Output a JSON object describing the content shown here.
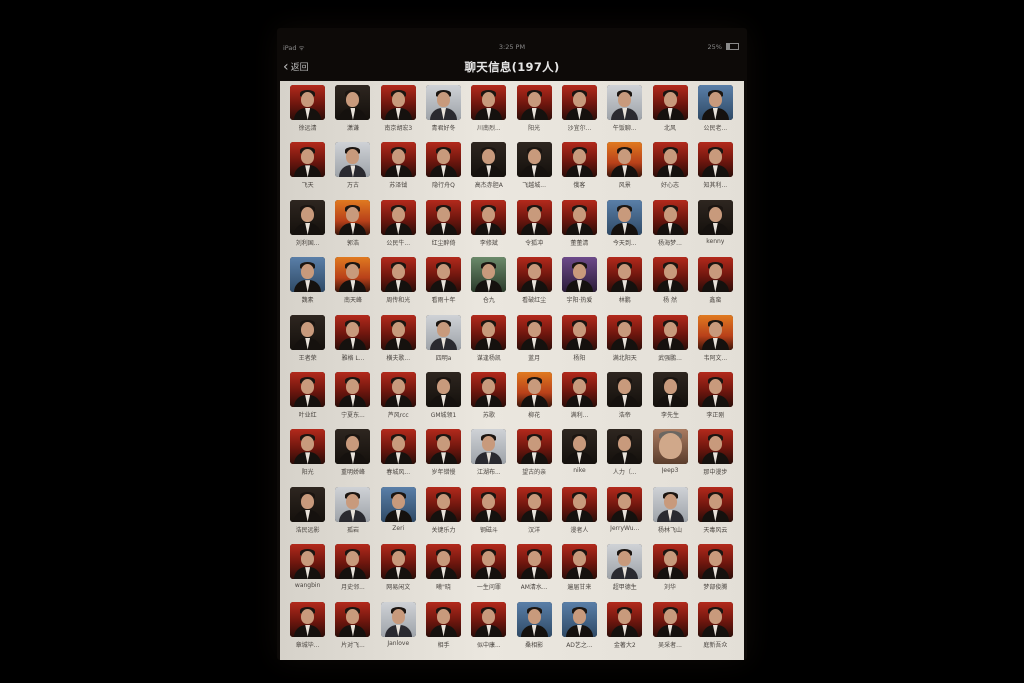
{
  "statusbar": {
    "device": "iPad ᯤ",
    "time": "3:25 PM",
    "battery": "25%"
  },
  "navbar": {
    "back_label": "返回",
    "title": "聊天信息(197人)"
  },
  "members": [
    {
      "name": "徐远清",
      "style": "red"
    },
    {
      "name": "潇谦",
      "style": "dark"
    },
    {
      "name": "南京胡宏3",
      "style": "red"
    },
    {
      "name": "青君好冬",
      "style": "light"
    },
    {
      "name": "川南烈...",
      "style": "red"
    },
    {
      "name": "阳光",
      "style": "red"
    },
    {
      "name": "沙宜尔...",
      "style": "red"
    },
    {
      "name": "午饭聊...",
      "style": "light"
    },
    {
      "name": "北风",
      "style": "red"
    },
    {
      "name": "公民老...",
      "style": "blue"
    },
    {
      "name": "飞天",
      "style": "red"
    },
    {
      "name": "万古",
      "style": "light"
    },
    {
      "name": "苏泽钺",
      "style": "red"
    },
    {
      "name": "隐行舟Q",
      "style": "red"
    },
    {
      "name": "高杰赤胆A",
      "style": "dark"
    },
    {
      "name": "飞越城...",
      "style": "dark"
    },
    {
      "name": "俄客",
      "style": "red"
    },
    {
      "name": "风景",
      "style": "orange"
    },
    {
      "name": "好心志",
      "style": "red"
    },
    {
      "name": "知其利...",
      "style": "red"
    },
    {
      "name": "刘利国...",
      "style": "dark"
    },
    {
      "name": "郭浩",
      "style": "orange"
    },
    {
      "name": "公民牛...",
      "style": "red"
    },
    {
      "name": "红尘醉倚",
      "style": "red"
    },
    {
      "name": "李修斌",
      "style": "red"
    },
    {
      "name": "令狐冲",
      "style": "red"
    },
    {
      "name": "董董清",
      "style": "red"
    },
    {
      "name": "今天到...",
      "style": "blue"
    },
    {
      "name": "杨海梦...",
      "style": "red"
    },
    {
      "name": "kenny",
      "style": "dark"
    },
    {
      "name": "魏素",
      "style": "blue"
    },
    {
      "name": "南天峰",
      "style": "orange"
    },
    {
      "name": "周传和光",
      "style": "red"
    },
    {
      "name": "看雨十年",
      "style": "red"
    },
    {
      "name": "仓九",
      "style": "green"
    },
    {
      "name": "看破红尘",
      "style": "red"
    },
    {
      "name": "宇阳·热爱",
      "style": "purple"
    },
    {
      "name": "林鹏",
      "style": "red"
    },
    {
      "name": "杨 然",
      "style": "red"
    },
    {
      "name": "鑫蛮",
      "style": "red"
    },
    {
      "name": "王者荣",
      "style": "dark"
    },
    {
      "name": "雅格 L...",
      "style": "red"
    },
    {
      "name": "横夫歌...",
      "style": "red"
    },
    {
      "name": "四明a",
      "style": "light"
    },
    {
      "name": "谋逢杨凯",
      "style": "red"
    },
    {
      "name": "蓝月",
      "style": "red"
    },
    {
      "name": "杨阳",
      "style": "red"
    },
    {
      "name": "满北阳天",
      "style": "red"
    },
    {
      "name": "武强鹏...",
      "style": "red"
    },
    {
      "name": "韦阿文...",
      "style": "orange"
    },
    {
      "name": "叶业红",
      "style": "red"
    },
    {
      "name": "宁夏东...",
      "style": "red"
    },
    {
      "name": "芦风rcc",
      "style": "red"
    },
    {
      "name": "GM城领1",
      "style": "dark"
    },
    {
      "name": "苏歌",
      "style": "red"
    },
    {
      "name": "柳花",
      "style": "orange"
    },
    {
      "name": "满利...",
      "style": "red"
    },
    {
      "name": "浩帝",
      "style": "dark"
    },
    {
      "name": "李先生",
      "style": "dark"
    },
    {
      "name": "李正刚",
      "style": "red"
    },
    {
      "name": "阳光",
      "style": "red"
    },
    {
      "name": "重明娇峰",
      "style": "dark"
    },
    {
      "name": "春城风...",
      "style": "red"
    },
    {
      "name": "岁年错慢",
      "style": "red"
    },
    {
      "name": "江湖布...",
      "style": "light"
    },
    {
      "name": "望古的亲",
      "style": "red"
    },
    {
      "name": "nike",
      "style": "dark"
    },
    {
      "name": "人力（...",
      "style": "dark"
    },
    {
      "name": "Jeep3",
      "style": "face"
    },
    {
      "name": "那中漫步",
      "style": "red"
    },
    {
      "name": "浩民远影",
      "style": "dark"
    },
    {
      "name": "孤岩",
      "style": "light"
    },
    {
      "name": "Zeri",
      "style": "blue"
    },
    {
      "name": "关键乐力",
      "style": "red"
    },
    {
      "name": "钢磁斗",
      "style": "red"
    },
    {
      "name": "汉洋",
      "style": "red"
    },
    {
      "name": "漫者人",
      "style": "red"
    },
    {
      "name": "JerryWu...",
      "style": "red"
    },
    {
      "name": "杨林飞山",
      "style": "light"
    },
    {
      "name": "天毒风云",
      "style": "red"
    },
    {
      "name": "wangbin",
      "style": "red"
    },
    {
      "name": "月史邻...",
      "style": "red"
    },
    {
      "name": "网易闲文",
      "style": "red"
    },
    {
      "name": "曦\"晓",
      "style": "red"
    },
    {
      "name": "一生问罪",
      "style": "red"
    },
    {
      "name": "AM清水...",
      "style": "red"
    },
    {
      "name": "遍届甘来",
      "style": "red"
    },
    {
      "name": "超甲德生",
      "style": "light"
    },
    {
      "name": "刘华",
      "style": "red"
    },
    {
      "name": "梦部俊腾",
      "style": "red"
    },
    {
      "name": "章城毕...",
      "style": "red"
    },
    {
      "name": "片对飞...",
      "style": "red"
    },
    {
      "name": "Janlove",
      "style": "light"
    },
    {
      "name": "相手",
      "style": "red"
    },
    {
      "name": "似中康...",
      "style": "red"
    },
    {
      "name": "桑相影",
      "style": "blue"
    },
    {
      "name": "AD艺之...",
      "style": "blue"
    },
    {
      "name": "金著大2",
      "style": "red"
    },
    {
      "name": "吴采者...",
      "style": "red"
    },
    {
      "name": "庭新吾众",
      "style": "red"
    }
  ]
}
